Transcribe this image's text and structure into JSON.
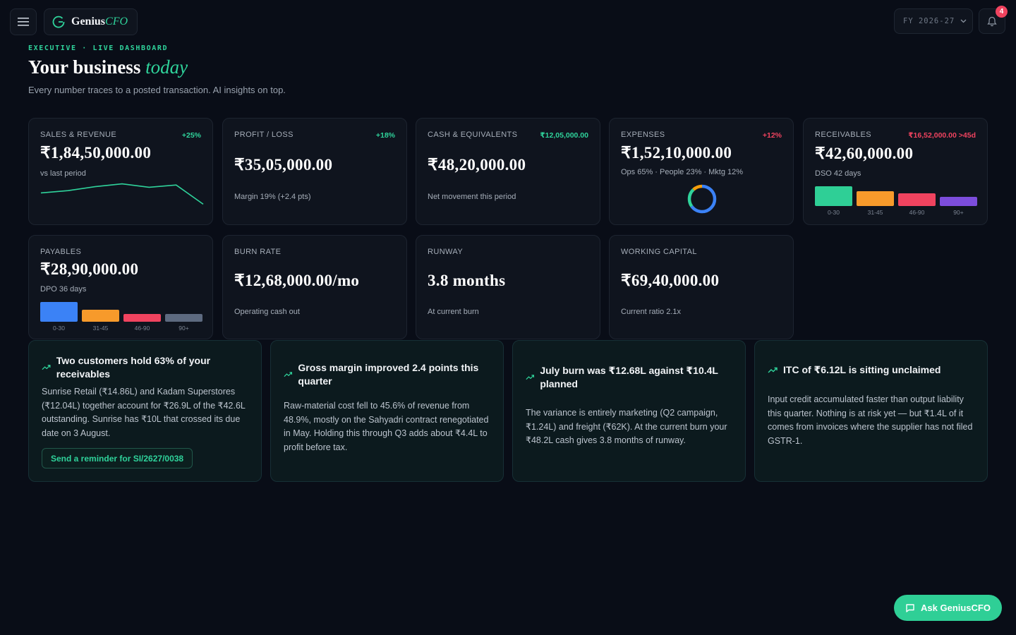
{
  "brand": {
    "name": "Genius",
    "suffix": "CFO"
  },
  "header": {
    "fy_label": "FY 2026-27",
    "notifications": "4"
  },
  "hero": {
    "eyebrow": "EXECUTIVE · LIVE DASHBOARD",
    "title": "Your business",
    "title_accent": "today",
    "subtitle": "Every number traces to a posted transaction. AI insights on top."
  },
  "kpis": {
    "sales": {
      "label": "SALES & REVENUE",
      "delta": "+25%",
      "value": "₹1,84,50,000.00",
      "sub": "vs last period",
      "sparkline": [
        3.2,
        3.6,
        4.3,
        4.8,
        4.2,
        4.6,
        1.2
      ]
    },
    "profit": {
      "label": "PROFIT / LOSS",
      "delta": "+18%",
      "value": "₹35,05,000.00",
      "sub": "Margin 19% (+2.4 pts)"
    },
    "cash": {
      "label": "CASH & EQUIVALENTS",
      "delta": "₹12,05,000.00",
      "value": "₹48,20,000.00",
      "sub": "Net movement this period"
    },
    "expenses": {
      "label": "EXPENSES",
      "delta": "+12%",
      "value": "₹1,52,10,000.00",
      "sub": "Ops 65% · People 23% · Mktg 12%",
      "breakdown": [
        {
          "name": "Ops",
          "pct": 65,
          "color": "#3b82f6"
        },
        {
          "name": "People",
          "pct": 23,
          "color": "#2fd39b"
        },
        {
          "name": "Mktg",
          "pct": 12,
          "color": "#f59e0b"
        }
      ]
    },
    "receivables": {
      "label": "RECEIVABLES",
      "delta": "₹16,52,000.00 >45d",
      "value": "₹42,60,000.00",
      "sub": "DSO 42 days",
      "buckets": [
        {
          "label": "0-30",
          "level": 1.0,
          "color": "#2fcf96"
        },
        {
          "label": "31-45",
          "level": 0.75,
          "color": "#f79a2b"
        },
        {
          "label": "46-90",
          "level": 0.65,
          "color": "#f0435f"
        },
        {
          "label": "90+",
          "level": 0.45,
          "color": "#7c4ddc"
        }
      ]
    },
    "payables": {
      "label": "PAYABLES",
      "value": "₹28,90,000.00",
      "sub": "DPO 36 days",
      "buckets": [
        {
          "label": "0-30",
          "level": 1.0,
          "color": "#3b82f6"
        },
        {
          "label": "31-45",
          "level": 0.6,
          "color": "#f79a2b"
        },
        {
          "label": "46-90",
          "level": 0.4,
          "color": "#f0435f"
        },
        {
          "label": "90+",
          "level": 0.4,
          "color": "#5d6a80"
        }
      ]
    },
    "burn": {
      "label": "BURN RATE",
      "value": "₹12,68,000.00/mo",
      "sub": "Operating cash out"
    },
    "runway": {
      "label": "RUNWAY",
      "value": "3.8 months",
      "sub": "At current burn"
    },
    "working_capital": {
      "label": "WORKING CAPITAL",
      "value": "₹69,40,000.00",
      "sub": "Current ratio 2.1x"
    }
  },
  "insights": [
    {
      "title": "Two customers hold 63% of your receivables",
      "body": "Sunrise Retail (₹14.86L) and Kadam Superstores (₹12.04L) together account for ₹26.9L of the ₹42.6L outstanding. Sunrise has ₹10L that crossed its due date on 3 August.",
      "action": "Send a reminder for SI/2627/0038"
    },
    {
      "title": "Gross margin improved 2.4 points this quarter",
      "body": "Raw-material cost fell to 45.6% of revenue from 48.9%, mostly on the Sahyadri contract renegotiated in May. Holding this through Q3 adds about ₹4.4L to profit before tax."
    },
    {
      "title": "July burn was ₹12.68L against ₹10.4L planned",
      "body": "The variance is entirely marketing (Q2 campaign, ₹1.24L) and freight (₹62K). At the current burn your ₹48.2L cash gives 3.8 months of runway."
    },
    {
      "title": "ITC of ₹6.12L is sitting unclaimed",
      "body": "Input credit accumulated faster than output liability this quarter. Nothing is at risk yet — but ₹1.4L of it comes from invoices where the supplier has not filed GSTR-1."
    }
  ],
  "ask_button": "Ask GeniusCFO"
}
